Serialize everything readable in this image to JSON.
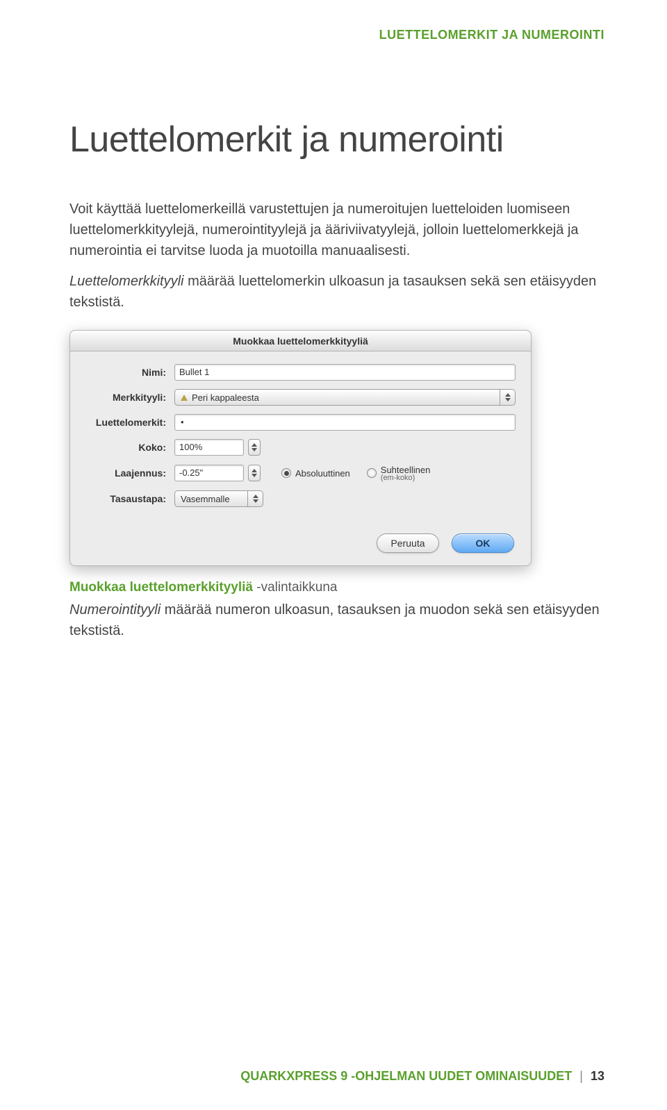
{
  "runningHead": "LUETTELOMERKIT JA NUMEROINTI",
  "title": "Luettelomerkit ja numerointi",
  "para1": "Voit käyttää luettelomerkeillä varustettujen ja numeroitujen luetteloiden luomiseen luettelomerkkityylejä, numerointityylejä ja ääriviivatyylejä, jolloin luettelomerkkejä ja numerointia ei tarvitse luoda ja muotoilla manuaalisesti.",
  "para2_prefix": "Luettelomerkkityyli",
  "para2_rest": " määrää luettelomerkin ulkoasun ja tasauksen sekä sen etäisyyden tekstistä.",
  "dialog": {
    "title": "Muokkaa luettelomerkkityyliä",
    "labels": {
      "nimi": "Nimi:",
      "merkkityyli": "Merkkityyli:",
      "luettelomerkit": "Luettelomerkit:",
      "koko": "Koko:",
      "laajennus": "Laajennus:",
      "tasaustapa": "Tasaustapa:"
    },
    "values": {
      "nimi": "Bullet 1",
      "merkkityyli": "Peri kappaleesta",
      "koko": "100%",
      "laajennus": "-0.25\"",
      "tasaustapa": "Vasemmalle"
    },
    "radios": {
      "abs": "Absoluuttinen",
      "rel": "Suhteellinen",
      "rel_sub": "(em-koko)"
    },
    "buttons": {
      "cancel": "Peruuta",
      "ok": "OK"
    }
  },
  "caption": {
    "strong": "Muokkaa luettelomerkkityyliä",
    "suffix": " -valintaikkuna"
  },
  "para3_prefix": "Numerointityyli",
  "para3_rest": " määrää numeron ulkoasun, tasauksen ja muodon sekä sen etäisyyden tekstistä.",
  "footer": {
    "text": "QUARKXPRESS 9 -OHJELMAN UUDET OMINAISUUDET",
    "page": "13"
  }
}
